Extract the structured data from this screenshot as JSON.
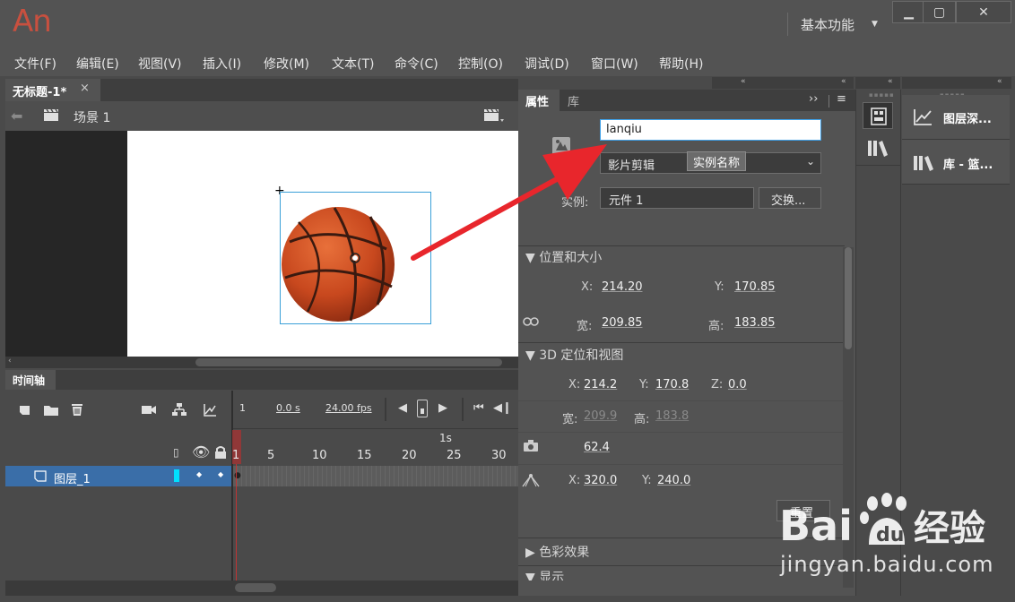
{
  "app": {
    "logo": "An",
    "workspace": "基本功能"
  },
  "window_controls": {
    "minimize": "▁",
    "maximize": "▢",
    "close": "✕"
  },
  "menu": [
    "文件(F)",
    "编辑(E)",
    "视图(V)",
    "插入(I)",
    "修改(M)",
    "文本(T)",
    "命令(C)",
    "控制(O)",
    "调试(D)",
    "窗口(W)",
    "帮助(H)"
  ],
  "document": {
    "tab_title": "无标题-1*",
    "close": "×",
    "scene": "场景 1"
  },
  "timeline": {
    "tab": "时间轴",
    "frame": "1",
    "time": "0.0 s",
    "fps": "24.00 fps",
    "second_marker": "1s",
    "ruler": [
      "1",
      "5",
      "10",
      "15",
      "20",
      "25",
      "30"
    ],
    "layer_name": "图层_1"
  },
  "properties": {
    "tabs": [
      "属性",
      "库"
    ],
    "instance_name_value": "lanqiu",
    "symbol_type": "影片剪辑",
    "tooltip": "实例名称",
    "instance_label": "实例:",
    "instance_value": "元件 1",
    "swap_button": "交换...",
    "section_position": "位置和大小",
    "x_label": "X:",
    "x_value": "214.20",
    "y_label": "Y:",
    "y_value": "170.85",
    "w_label": "宽:",
    "w_value": "209.85",
    "h_label": "高:",
    "h_value": "183.85",
    "section_3d": "3D 定位和视图",
    "x3d_label": "X:",
    "x3d_value": "214.2",
    "y3d_label": "Y:",
    "y3d_value": "170.8",
    "z3d_label": "Z:",
    "z3d_value": "0.0",
    "w3d_label": "宽:",
    "w3d_value": "209.9",
    "h3d_label": "高:",
    "h3d_value": "183.8",
    "perspective_value": "62.4",
    "vp_x_label": "X:",
    "vp_x_value": "320.0",
    "vp_y_label": "Y:",
    "vp_y_value": "240.0",
    "reset_button": "重置",
    "section_color": "色彩效果",
    "section_display": "显示"
  },
  "right_panels": [
    "图层深...",
    "库 - 篮..."
  ],
  "watermark": {
    "text": "Bai du 经验",
    "url_text": "jingyan.baidu.com"
  },
  "colors": {
    "accent_red": "#e8262c",
    "layer_blue": "#3a6ea8",
    "logo": "#c8503f"
  }
}
